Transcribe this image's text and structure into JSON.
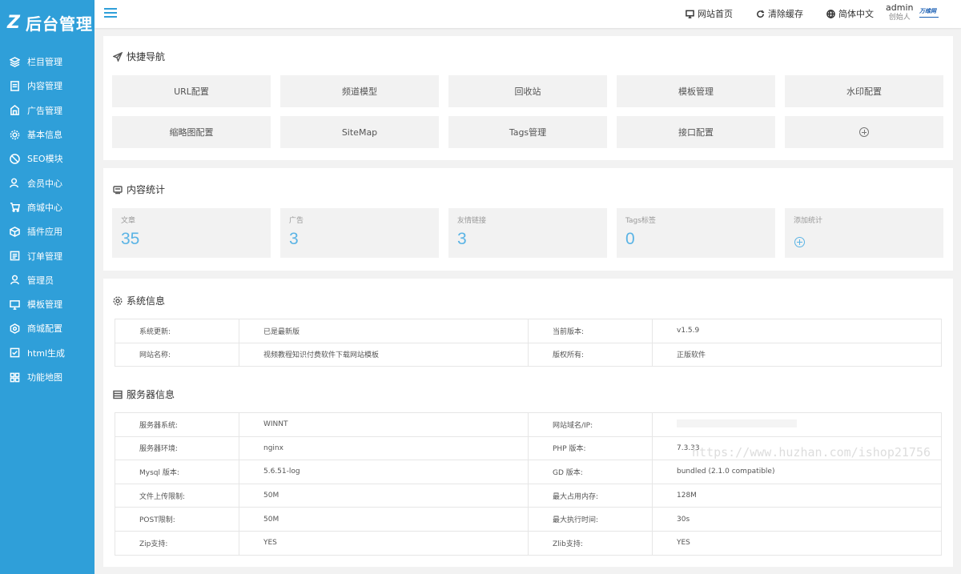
{
  "logo": {
    "mark": "Z",
    "text": "后台管理"
  },
  "sidebar": {
    "items": [
      {
        "label": "栏目管理",
        "icon": "layers-icon"
      },
      {
        "label": "内容管理",
        "icon": "document-icon"
      },
      {
        "label": "广告管理",
        "icon": "ad-icon"
      },
      {
        "label": "基本信息",
        "icon": "gear-icon"
      },
      {
        "label": "SEO模块",
        "icon": "seo-icon"
      },
      {
        "label": "会员中心",
        "icon": "user-icon"
      },
      {
        "label": "商城中心",
        "icon": "cart-icon"
      },
      {
        "label": "插件应用",
        "icon": "box-icon"
      },
      {
        "label": "订单管理",
        "icon": "order-icon"
      },
      {
        "label": "管理员",
        "icon": "admin-icon"
      },
      {
        "label": "模板管理",
        "icon": "monitor-icon"
      },
      {
        "label": "商城配置",
        "icon": "shop-config-icon"
      },
      {
        "label": "html生成",
        "icon": "check-square-icon"
      },
      {
        "label": "功能地图",
        "icon": "grid-icon"
      }
    ]
  },
  "header": {
    "site_home": "网站首页",
    "clear_cache": "清除缓存",
    "language": "简体中文",
    "user_name": "admin",
    "user_role": "创始人",
    "avatar_text": "万维网"
  },
  "quick_nav": {
    "title": "快捷导航",
    "buttons": [
      "URL配置",
      "频道模型",
      "回收站",
      "模板管理",
      "水印配置",
      "缩略图配置",
      "SiteMap",
      "Tags管理",
      "接口配置"
    ]
  },
  "stats": {
    "title": "内容统计",
    "cards": [
      {
        "label": "文章",
        "value": "35"
      },
      {
        "label": "广告",
        "value": "3"
      },
      {
        "label": "友情链接",
        "value": "3"
      },
      {
        "label": "Tags标签",
        "value": "0"
      }
    ],
    "add_label": "添加统计"
  },
  "system_info": {
    "title": "系统信息",
    "rows": [
      [
        "系统更新:",
        "已是最新版",
        "当前版本:",
        "v1.5.9"
      ],
      [
        "网站名称:",
        "视频教程知识付费软件下载网站模板",
        "版权所有:",
        "正版软件"
      ]
    ]
  },
  "server_info": {
    "title": "服务器信息",
    "rows": [
      [
        "服务器系统:",
        "WINNT",
        "网站域名/IP:",
        ""
      ],
      [
        "服务器环境:",
        "nginx",
        "PHP 版本:",
        "7.3.33"
      ],
      [
        "Mysql 版本:",
        "5.6.51-log",
        "GD 版本:",
        "bundled (2.1.0 compatible)"
      ],
      [
        "文件上传限制:",
        "50M",
        "最大占用内存:",
        "128M"
      ],
      [
        "POST限制:",
        "50M",
        "最大执行时间:",
        "30s"
      ],
      [
        "Zip支持:",
        "YES",
        "Zlib支持:",
        "YES"
      ]
    ]
  },
  "watermark": "https://www.huzhan.com/ishop21756",
  "colors": {
    "sidebar": "#2f9fd9",
    "accent": "#5bb4e5",
    "background": "#f2f2f2"
  }
}
